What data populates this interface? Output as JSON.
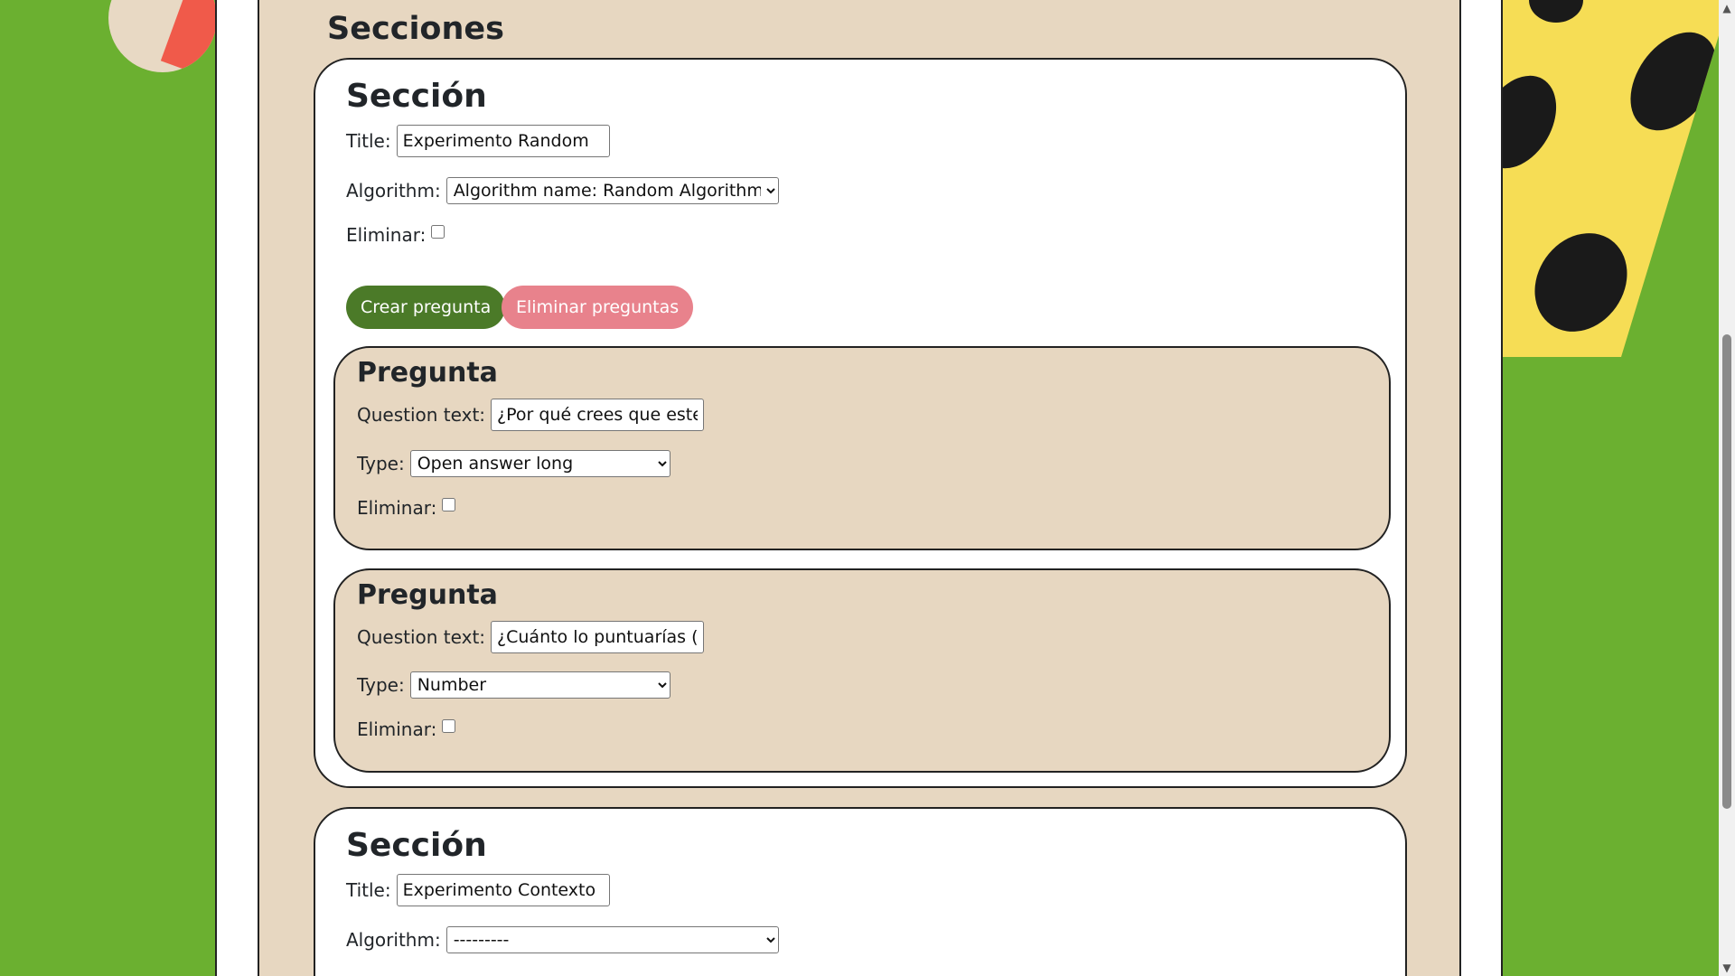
{
  "page": {
    "heading": "Secciones"
  },
  "sections": [
    {
      "heading": "Sección",
      "title_label": "Title:",
      "title_value": "Experimento Random",
      "algorithm_label": "Algorithm:",
      "algorithm_value": "Algorithm name: Random Algorithm",
      "delete_label": "Eliminar:",
      "create_question_button": "Crear pregunta",
      "delete_questions_button": "Eliminar preguntas",
      "questions": [
        {
          "heading": "Pregunta",
          "question_text_label": "Question text:",
          "question_text_value": "¿Por qué crees que este juego",
          "type_label": "Type:",
          "type_value": "Open answer long",
          "delete_label": "Eliminar:"
        },
        {
          "heading": "Pregunta",
          "question_text_label": "Question text:",
          "question_text_value": "¿Cuánto lo puntuarías (siendo",
          "type_label": "Type:",
          "type_value": "Number",
          "delete_label": "Eliminar:"
        }
      ]
    },
    {
      "heading": "Sección",
      "title_label": "Title:",
      "title_value": "Experimento Contexto",
      "algorithm_label": "Algorithm:",
      "algorithm_value": "---------"
    }
  ],
  "scrollbar": {
    "up_arrow": "▲",
    "down_arrow": "▼"
  },
  "colors": {
    "background_green": "#6bb030",
    "panel_beige": "#e7d7c1",
    "create_button": "#4b7a28",
    "delete_button": "#e8828c"
  }
}
